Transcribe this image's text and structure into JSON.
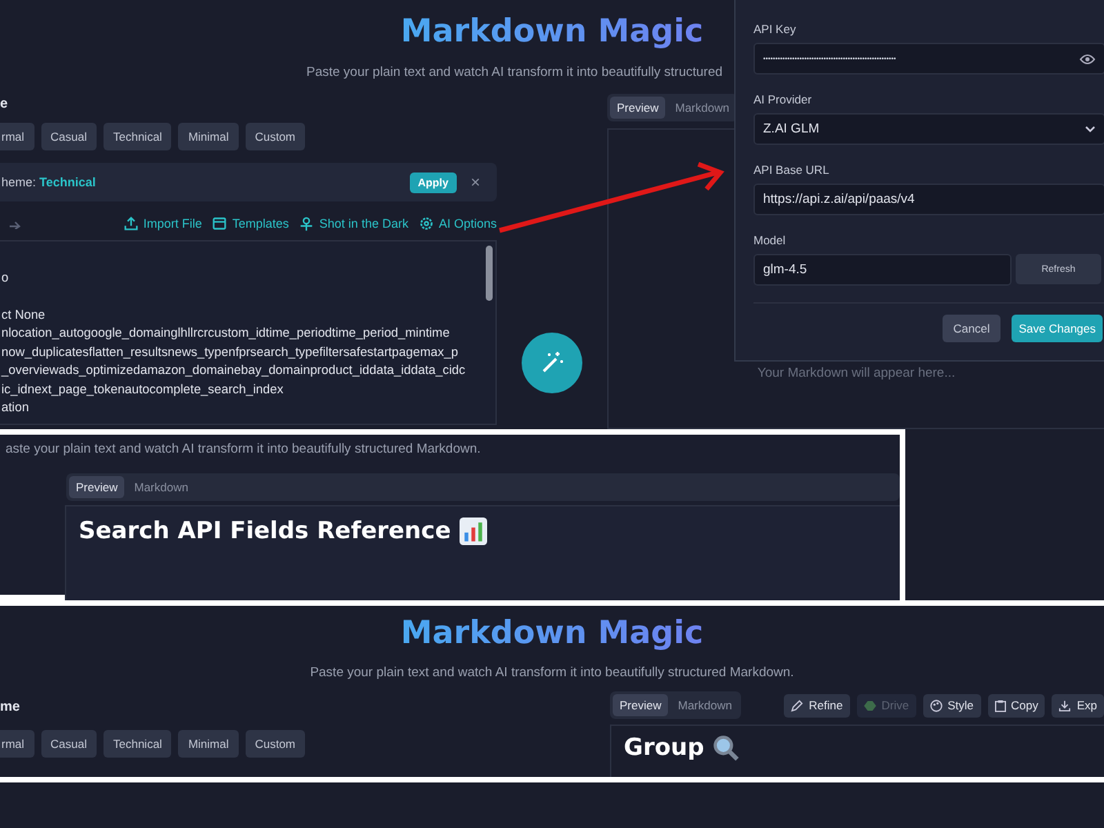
{
  "top_screen": {
    "title": "Markdown Magic",
    "subtitle": "Paste your plain text and watch AI transform it into beautifully structured",
    "section_label": "e",
    "tones": [
      "rmal",
      "Casual",
      "Technical",
      "Minimal",
      "Custom"
    ],
    "theme_bar": {
      "label": "heme:",
      "value": "Technical",
      "apply": "Apply",
      "close": "×"
    },
    "toolbar": [
      "Import File",
      "Templates",
      "Shot in the Dark",
      "AI Options"
    ],
    "editor_paragraphs": [
      [
        "o"
      ],
      [
        "ct None",
        "nlocation_autogoogle_domainglhllrcrcustom_idtime_periodtime_period_mintime",
        "now_duplicatesflatten_resultsnews_typenfprsearch_typefiltersafestartpagemax_p",
        "_overviewads_optimizedamazon_domainebay_domainproduct_iddata_iddata_cidc",
        "ic_idnext_page_tokenautocomplete_search_index",
        "ation"
      ]
    ],
    "preview_tabs": [
      {
        "label": "Preview",
        "selected": true
      },
      {
        "label": "Markdown",
        "selected": false
      }
    ],
    "empty_message": "Your Markdown will appear here..."
  },
  "settings_modal": {
    "fields": [
      {
        "kind": "password",
        "label": "API Key",
        "value": "•••••••••••••••••••••••••••••••••••••••••••••••••••••••"
      },
      {
        "kind": "select",
        "label": "AI Provider",
        "value": "Z.AI GLM"
      },
      {
        "kind": "text",
        "label": "API Base URL",
        "value": "https://api.z.ai/api/paas/v4"
      },
      {
        "kind": "model",
        "label": "Model",
        "value": "glm-4.5",
        "button": "Refresh"
      }
    ],
    "buttons": [
      {
        "label": "Cancel",
        "kind": "secondary"
      },
      {
        "label": "Save Changes",
        "kind": "primary"
      }
    ]
  },
  "inset": {
    "subtitle": "aste your plain text and watch AI transform it into beautifully structured Markdown.",
    "preview_tabs": [
      {
        "label": "Preview",
        "selected": true
      },
      {
        "label": "Markdown",
        "selected": false
      }
    ],
    "heading": "Search API Fields Reference"
  },
  "bottom_screen": {
    "title": "Markdown Magic",
    "subtitle": "Paste your plain text and watch AI transform it into beautifully structured Markdown.",
    "section_label": "me",
    "tones": [
      "rmal",
      "Casual",
      "Technical",
      "Minimal",
      "Custom"
    ],
    "preview_tabs": [
      {
        "label": "Preview",
        "selected": true
      },
      {
        "label": "Markdown",
        "selected": false
      }
    ],
    "actions": [
      {
        "label": "Refine",
        "disabled": false
      },
      {
        "label": "Drive",
        "disabled": true
      },
      {
        "label": "Style",
        "disabled": false
      },
      {
        "label": "Copy",
        "disabled": false
      },
      {
        "label": "Exp",
        "disabled": false
      }
    ],
    "heading": "Group"
  }
}
